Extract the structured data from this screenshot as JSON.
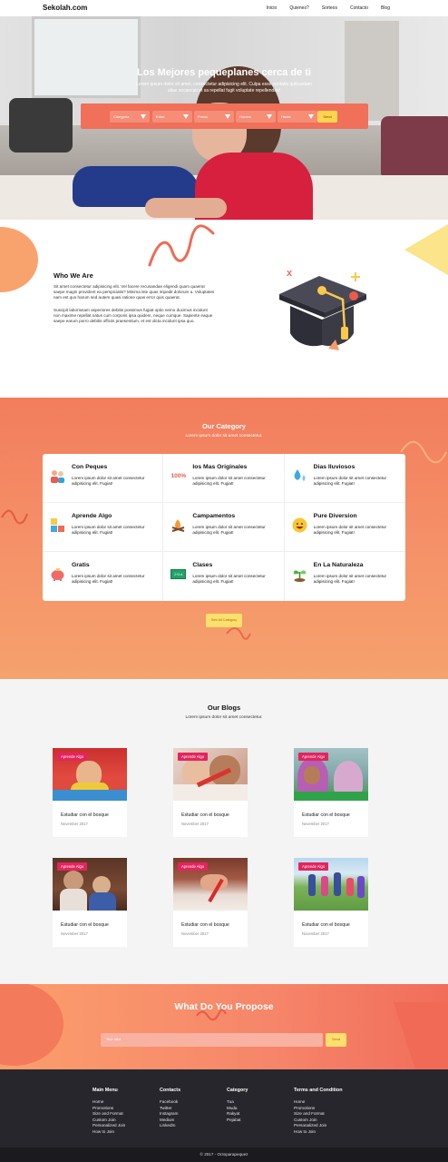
{
  "nav": {
    "brand": "Sekolah.com",
    "items": [
      "Inicio",
      "Quienes?",
      "Sorteos",
      "Contacto",
      "Blog"
    ]
  },
  "hero": {
    "title": "Los Mejores pequeplanes cerca de ti",
    "subtitle": "Lorem ipsum dolor sit amet, consectetur adipisicing elit. Culpa esse veritatis quibusdam alias occaecati et sa repellat fugit voluptate repellendus!",
    "filters": [
      "Categoria",
      "Edad",
      "Precio",
      "Horario",
      "Hasta"
    ],
    "search_label": "Send"
  },
  "who": {
    "title": "Who We Are",
    "p1": "Sit amet consectetur adipisicing elit. Vel facere recusandae eligendi quam quaerat saepe magni provident ea perspiciatis? Minima iste quas impedit dolorum a. Voluptates nam est quo harum sed autem quasi ratione quas error quis quaerat.",
    "p2": "Suscipit laboriosam asperiores debitis possimus fugiat optio nemo ducimus incidunt non maxime repellat natus cum corporis ipsa quidem, neque cumque. Sapiente eaque saepe earum porro debitis officiis praesentium, et est dicta incidunt ipsa quo."
  },
  "category": {
    "title": "Our Category",
    "subtitle": "Lorem ipsum dolor sit amet consectetur.",
    "items": [
      {
        "title": "Con Peques",
        "desc": "Lorem ipsum dolor sit amet consectetur adipisicing elit. Fugiat!",
        "icon": "family-icon"
      },
      {
        "title": "Ios Mas Originales",
        "desc": "Lorem ipsum dolor sit amet consectetur adipisicing elit. Fugiat!",
        "icon": "hundred-percent-icon",
        "icon_text": "100%"
      },
      {
        "title": "Dias Iluviosos",
        "desc": "Lorem ipsum dolor sit amet consectetur adipisicing elit. Fugiat!",
        "icon": "raindrops-icon"
      },
      {
        "title": "Aprende Algo",
        "desc": "Lorem ipsum dolor sit amet consectetur adipisicing elit. Fugiat!",
        "icon": "abc-blocks-icon"
      },
      {
        "title": "Campamentos",
        "desc": "Lorem ipsum dolor sit amet consectetur adipisicing elit. Fugiat!",
        "icon": "campfire-icon"
      },
      {
        "title": "Pure Diversion",
        "desc": "Lorem ipsum dolor sit amet consectetur adipisicing elit. Fugiat!",
        "icon": "smiley-icon"
      },
      {
        "title": "Gratis",
        "desc": "Lorem ipsum dolor sit amet consectetur adipisicing elit. Fugiat!",
        "icon": "piggy-bank-icon"
      },
      {
        "title": "Clases",
        "desc": "Lorem ipsum dolor sit amet consectetur adipisicing elit. Fugiat!",
        "icon": "chalkboard-icon",
        "icon_text": "2+2=4"
      },
      {
        "title": "En La Naturaleza",
        "desc": "Lorem ipsum dolor sit amet consectetur adipisicing elit. Fugiat!",
        "icon": "sprout-icon"
      }
    ],
    "button": "See All Category"
  },
  "blogs": {
    "title": "Our Blogs",
    "subtitle": "Lorem ipsum dolor sit amet consectetur.",
    "cards": [
      {
        "tag": "Aprende Algo",
        "title": "Estudiar con el bosque",
        "date": "November 2017"
      },
      {
        "tag": "Aprende Algo",
        "title": "Estudiar con el bosque",
        "date": "November 2017"
      },
      {
        "tag": "Aprende Algo",
        "title": "Estudiar con el bosque",
        "date": "November 2017"
      },
      {
        "tag": "Aprende Algo",
        "title": "Estudiar con el bosque",
        "date": "November 2017"
      },
      {
        "tag": "Aprende Algo",
        "title": "Estudiar con el bosque",
        "date": "November 2017"
      },
      {
        "tag": "Aprende Algo",
        "title": "Estudiar con el bosque",
        "date": "November 2017"
      }
    ]
  },
  "propose": {
    "title": "What Do You Propose",
    "placeholder": "Your Idea",
    "button": "Send"
  },
  "footer": {
    "columns": [
      {
        "title": "Main Menu",
        "links": [
          "Home",
          "Promotions",
          "Size and Format",
          "Custom Join",
          "Personalized Join",
          "How to Join"
        ]
      },
      {
        "title": "Contacts",
        "links": [
          "Facebook",
          "Twitter",
          "Instagram",
          "Medium",
          "LinkedIn"
        ]
      },
      {
        "title": "Category",
        "links": [
          "Tua",
          "Muda",
          "Rakyat",
          "Pejabat"
        ]
      },
      {
        "title": "Terms and Condition",
        "links": [
          "Home",
          "Promotions",
          "Size and Format",
          "Custom Join",
          "Personalized Join",
          "How to Join"
        ]
      }
    ],
    "copyright": "© 2017 - Octoparapequez"
  },
  "colors": {
    "accent": "#f0705a",
    "yellow": "#fde06b",
    "tag": "#e4245e",
    "footer": "#26262c"
  }
}
